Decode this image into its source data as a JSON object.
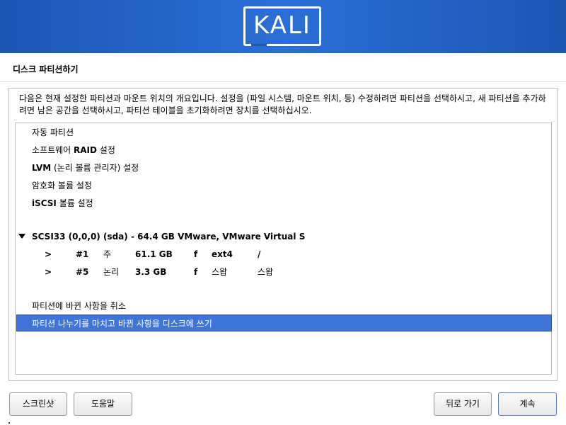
{
  "logo": "KALI",
  "window_title": "디스크 파티션하기",
  "description": "다음은 현재 설정한 파티션과 마운트 위치의 개요입니다. 설정을 (파일 시스템, 마운트 위치, 등) 수정하려면 파티션을 선택하시고, 새 파티션을 추가하려면 남은 공간을 선택하시고, 파티션 테이블을 초기화하려면 장치를 선택하십시오.",
  "options": {
    "auto": "자동 파티션",
    "raid_pre": "소프트웨어 ",
    "raid_bold": "RAID",
    "raid_post": " 설정",
    "lvm_bold": "LVM",
    "lvm_post": " (논리 볼륨 관리자) 설정",
    "encrypt": "암호화 볼륨 설정",
    "iscsi_bold": "iSCSI",
    "iscsi_post": " 볼륨 설정"
  },
  "disk": {
    "label": "SCSI33 (0,0,0) (sda) - 64.4 GB VMware, VMware Virtual S",
    "partitions": [
      {
        "arrow": ">",
        "number": "#1",
        "type": "주",
        "size": "61.1 GB",
        "flag": "f",
        "fs": "ext4",
        "mount": "/"
      },
      {
        "arrow": ">",
        "number": "#5",
        "type": "논리",
        "size": "3.3 GB",
        "flag": "f",
        "fs": "스왑",
        "mount": "스왑"
      }
    ]
  },
  "actions": {
    "undo": "파티션에 바뀐 사항을 취소",
    "finish": "파티션 나누기를 마치고 바뀐 사항을 디스크에 쓰기"
  },
  "buttons": {
    "screenshot": "스크린샷",
    "help": "도움말",
    "back": "뒤로 가기",
    "continue": "계속"
  },
  "colors": {
    "banner": "#1e55b4",
    "selection": "#3f74d8"
  }
}
